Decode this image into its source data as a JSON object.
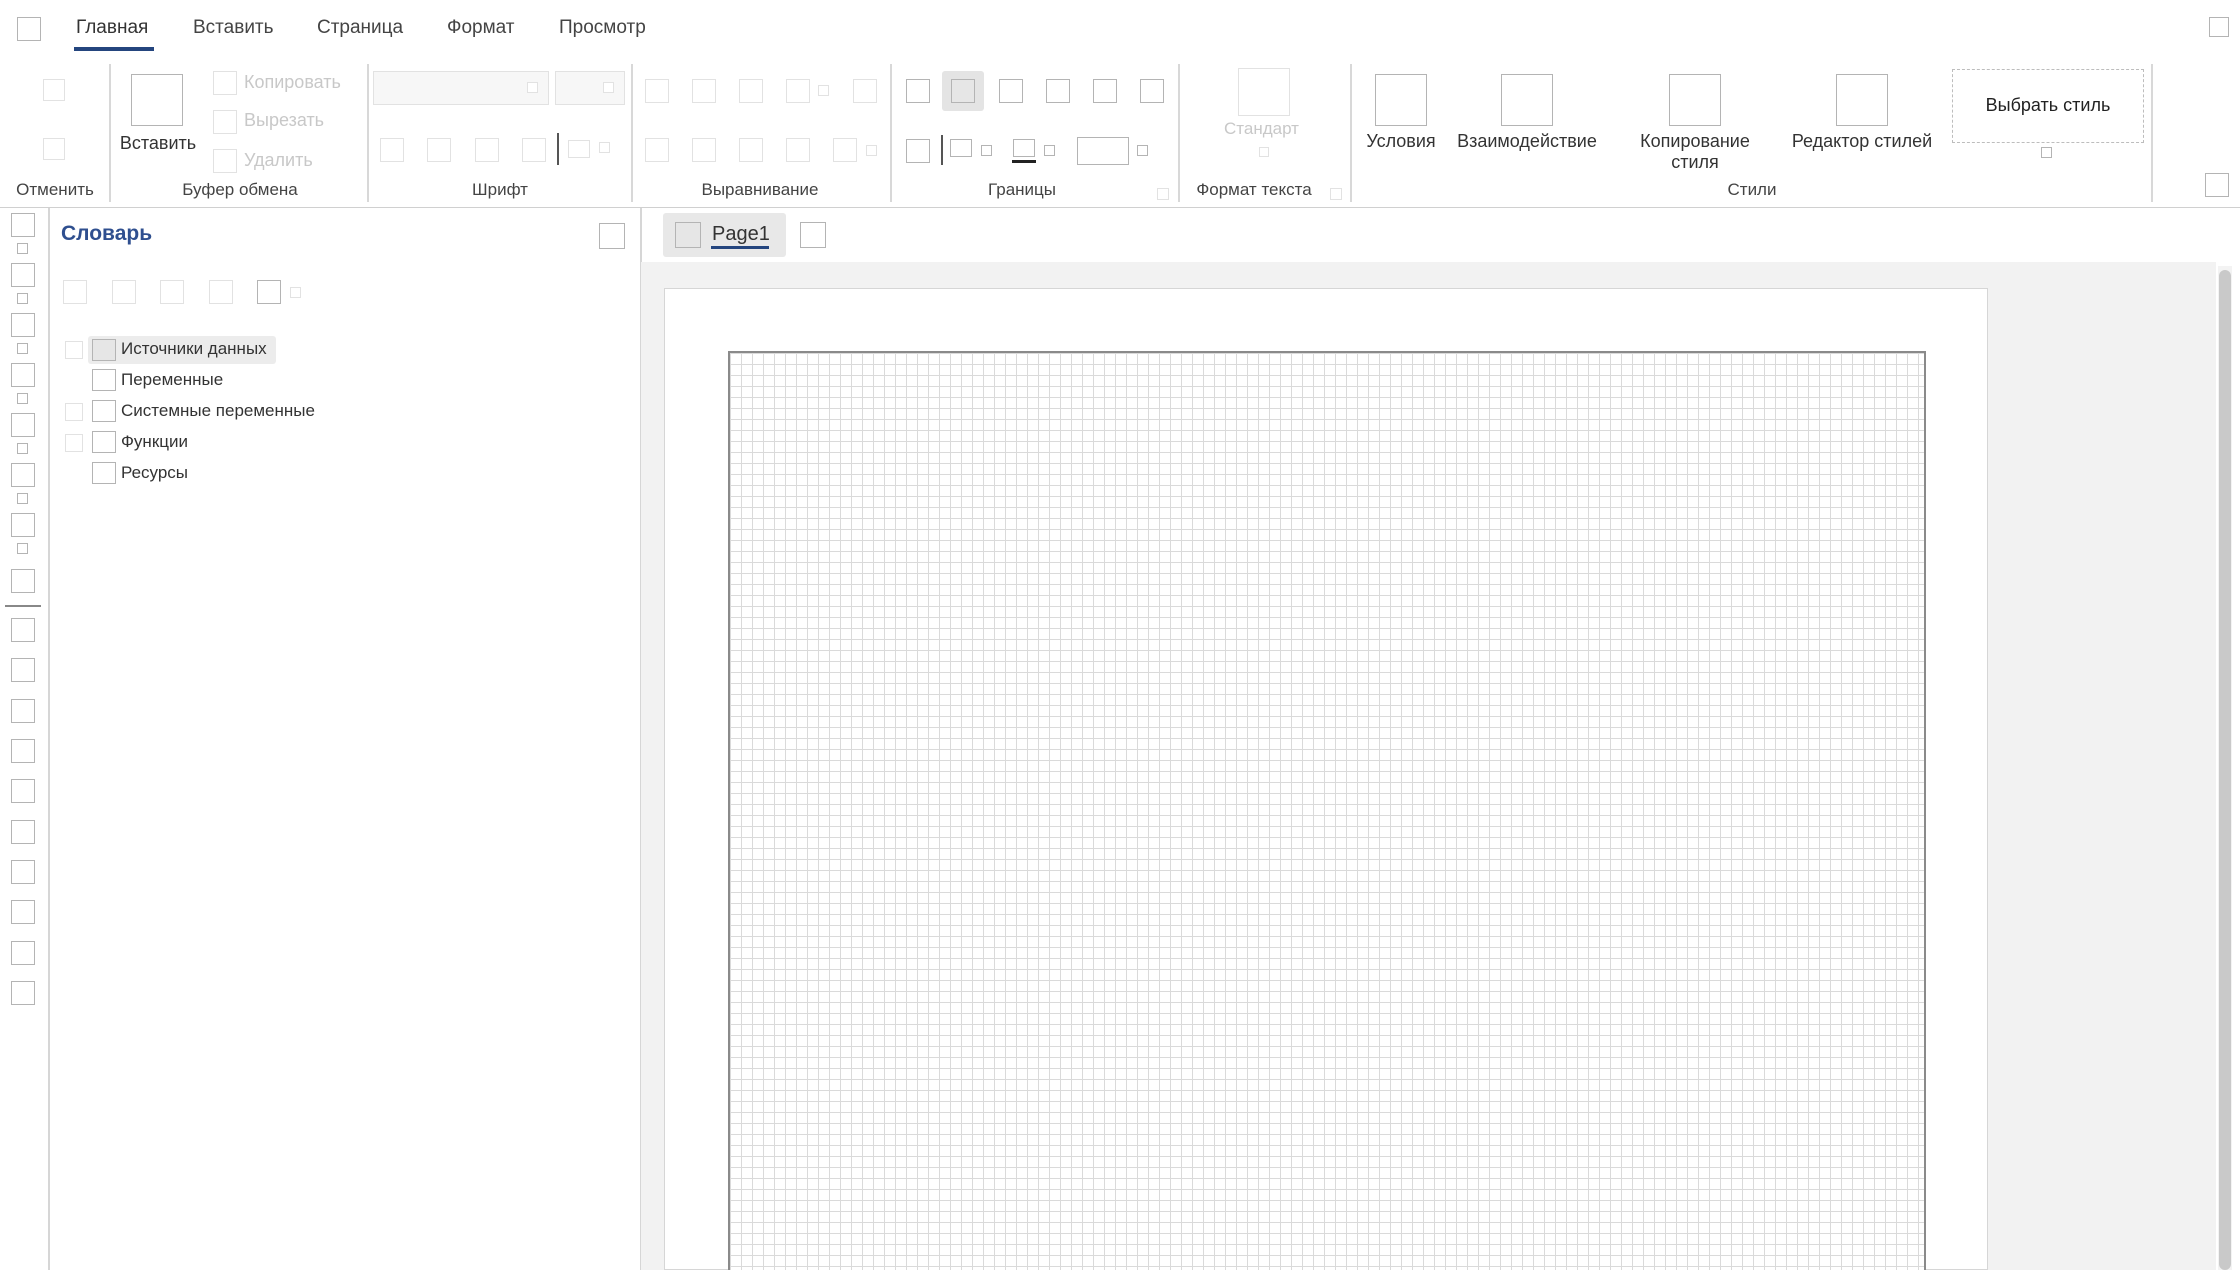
{
  "tabs": [
    {
      "label": "Главная",
      "active": true
    },
    {
      "label": "Вставить"
    },
    {
      "label": "Страница"
    },
    {
      "label": "Формат"
    },
    {
      "label": "Просмотр"
    }
  ],
  "ribbon": {
    "undo_group": "Отменить",
    "clipboard": {
      "paste": "Вставить",
      "copy": "Копировать",
      "cut": "Вырезать",
      "delete": "Удалить",
      "group": "Буфер обмена"
    },
    "font_group": "Шрифт",
    "alignment_group": "Выравнивание",
    "borders_group": "Границы",
    "text_format": {
      "standard": "Стандарт",
      "group": "Формат текста"
    },
    "styles": {
      "conditions": "Условия",
      "interaction": "Взаимодействие",
      "copy_style_line1": "Копирование",
      "copy_style_line2": "стиля",
      "style_editor": "Редактор стилей",
      "choose_style": "Выбрать стиль",
      "group": "Стили"
    }
  },
  "dictionary": {
    "title": "Словарь",
    "items": [
      {
        "label": "Источники данных",
        "expandable": true,
        "selected": true
      },
      {
        "label": "Переменные",
        "expandable": false
      },
      {
        "label": "Системные переменные",
        "expandable": true
      },
      {
        "label": "Функции",
        "expandable": true
      },
      {
        "label": "Ресурсы",
        "expandable": false
      }
    ]
  },
  "page_tabs": [
    {
      "label": "Page1",
      "active": true
    }
  ],
  "colors": {
    "accent": "#24457e",
    "title": "#2f4f8f"
  },
  "icons": [
    "app-menu-icon",
    "ribbon-collapse-icon",
    "panel-settings-icon",
    "add-page-icon"
  ]
}
